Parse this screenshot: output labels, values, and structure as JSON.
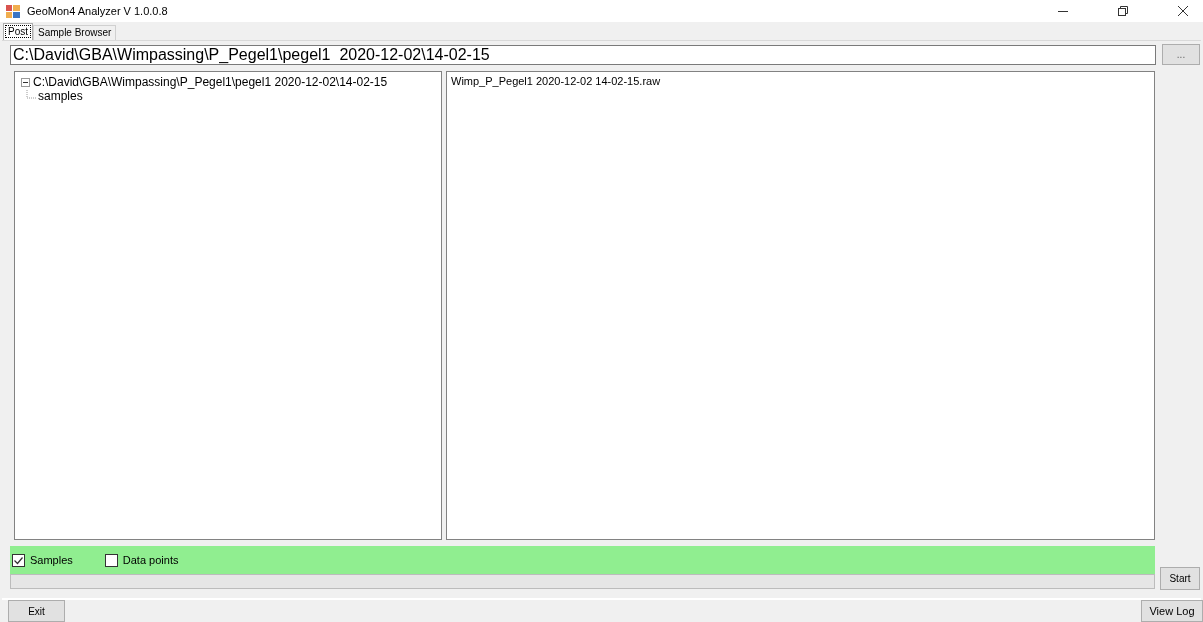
{
  "window": {
    "title": "GeoMon4 Analyzer  V 1.0.0.8"
  },
  "tabs": [
    {
      "label": "Post",
      "selected": true
    },
    {
      "label": "Sample Browser",
      "selected": false
    }
  ],
  "path_field": {
    "value": "C:\\David\\GBA\\Wimpassing\\P_Pegel1\\pegel1  2020-12-02\\14-02-15"
  },
  "browse_button": "...",
  "tree": [
    {
      "label": "C:\\David\\GBA\\Wimpassing\\P_Pegel1\\pegel1  2020-12-02\\14-02-15",
      "expanded": true,
      "children": [
        {
          "label": "samples"
        }
      ]
    }
  ],
  "files": [
    "Wimp_P_Pegel1 2020-12-02 14-02-15.raw"
  ],
  "options": [
    {
      "label": "Samples",
      "checked": true
    },
    {
      "label": "Data points",
      "checked": false
    }
  ],
  "progress": {
    "level": 0
  },
  "start_button": "Start",
  "exit_button": "Exit",
  "view_log_button": "View Log"
}
